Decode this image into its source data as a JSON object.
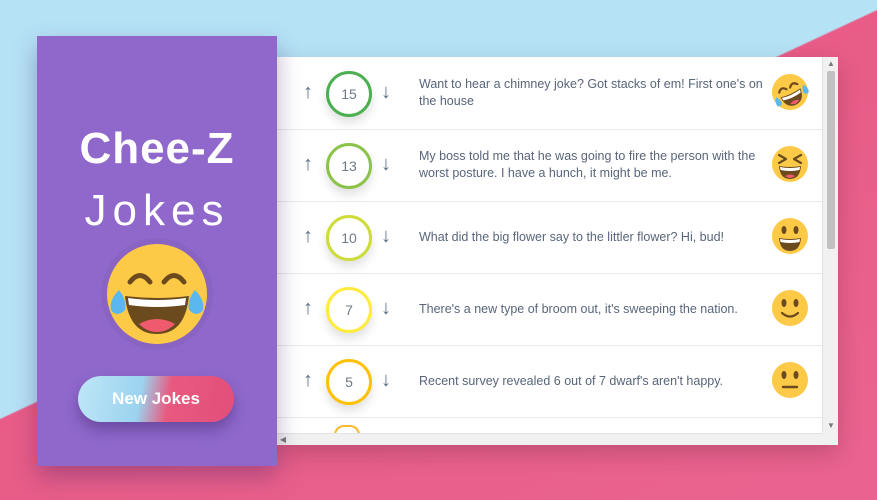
{
  "app": {
    "title_main": "Chee-Z",
    "title_sub": "Jokes",
    "hero_icon": "laughing-tears-icon",
    "new_jokes_label": "New Jokes"
  },
  "colors": {
    "sidebar": "#9068cc",
    "bg_blue": "#b6e2f6",
    "bg_pink": "#e85c87",
    "text": "#58657a",
    "arrow": "#5b6c85"
  },
  "icons": {
    "upvote": "arrow-up-icon",
    "downvote": "arrow-down-icon"
  },
  "arrows": {
    "up": "↑",
    "down": "↓"
  },
  "jokes": [
    {
      "votes": "15",
      "text": "Want to hear a chimney joke? Got stacks of em! First one's on the house",
      "ring_color": "#4caf50",
      "emoji": "rolling-laughing-icon"
    },
    {
      "votes": "13",
      "text": "My boss told me that he was going to fire the person with the worst posture. I have a hunch, it might be me.",
      "ring_color": "#8bc34a",
      "emoji": "squinting-laugh-icon"
    },
    {
      "votes": "10",
      "text": "What did the big flower say to the littler flower? Hi, bud!",
      "ring_color": "#cddc39",
      "emoji": "grinning-icon"
    },
    {
      "votes": "7",
      "text": "There's a new type of broom out, it's sweeping the nation.",
      "ring_color": "#ffeb3b",
      "emoji": "slight-smile-icon"
    },
    {
      "votes": "5",
      "text": "Recent survey revealed 6 out of 7 dwarf's aren't happy.",
      "ring_color": "#ffc107",
      "emoji": "neutral-face-icon"
    }
  ]
}
